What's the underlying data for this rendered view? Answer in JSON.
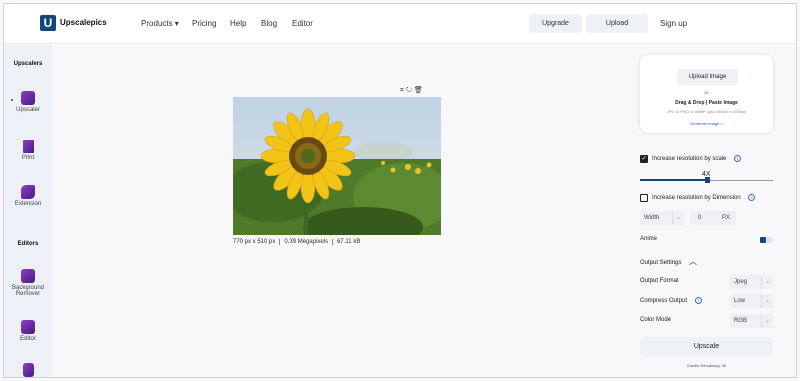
{
  "brand": {
    "logo_letter": "U",
    "name": "Upscalepics",
    "color": "#15467a"
  },
  "nav": {
    "products": "Products ▾",
    "pricing": "Pricing",
    "help": "Help",
    "blog": "Blog",
    "editor": "Editor"
  },
  "header_actions": {
    "upgrade": "Upgrade",
    "upload": "Upload",
    "signup": "Sign up"
  },
  "sidebar": {
    "upscalers_heading": "Upscalers",
    "editors_heading": "Editors",
    "items": [
      {
        "label": "Upscaler",
        "icon": "upscaler-icon"
      },
      {
        "label": "Print",
        "icon": "print-icon"
      },
      {
        "label": "Extension",
        "icon": "puzzle-icon"
      },
      {
        "label": "Background Remover",
        "icon": "background-remover-icon"
      },
      {
        "label": "Editor",
        "icon": "edit-icon"
      }
    ]
  },
  "image": {
    "description_icon": "sunflower-photo",
    "dimensions": "770 px x 510 px",
    "megapixels": "0.39 Megapixels",
    "size": "67.11 kB",
    "tools": [
      "crop-icon",
      "rotate-icon",
      "trash-icon"
    ]
  },
  "upload_card": {
    "button": "Upload Image",
    "or": "Or",
    "drag_drop": "Drag & Drop | Paste Image",
    "formats": "JPG or PNG or WebP upto 4000px x 4000px",
    "generate": "Generate Image ⤶"
  },
  "settings": {
    "scale_label": "Increase resolution by scale",
    "scale_checked": true,
    "scale_value": "4X",
    "scale_fraction": 0.5,
    "dimension_label": "Increase resolution by Dimension",
    "dimension_checked": false,
    "width_label": "Width",
    "width_value": "0",
    "unit": "PX",
    "anime_label": "Anime",
    "anime_on": false,
    "output_settings": "Output Settings",
    "output_format_label": "Output Format",
    "output_format_value": "Jpeg",
    "compress_label": "Compress Output",
    "compress_value": "Low",
    "color_mode_label": "Color Mode",
    "color_mode_value": "RGB",
    "upscale_button": "Upscale",
    "credits": "Credits Remaining: 50"
  }
}
